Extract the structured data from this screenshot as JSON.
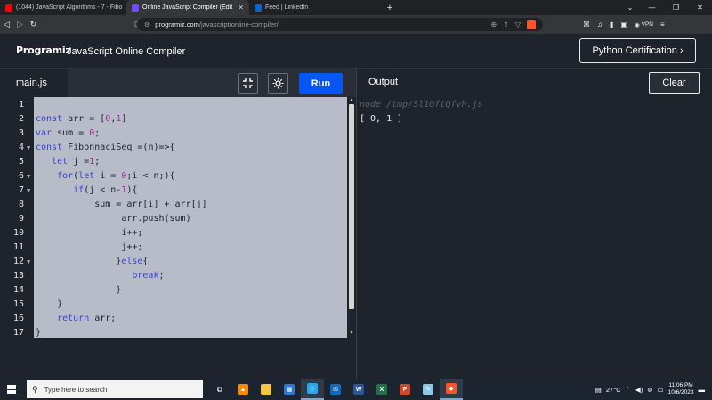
{
  "browser": {
    "tabs": [
      {
        "title": "(1044) JavaScript Algorithms - 7 - Fibo",
        "color": "#ff0000"
      },
      {
        "title": "Online JavaScript Compiler (Edit",
        "color": "#6c4df6",
        "active": true
      },
      {
        "title": "Feed | LinkedIn",
        "color": "#0a66c2"
      }
    ],
    "new_tab_label": "+",
    "address": {
      "host": "programiz.com",
      "path": "/javascript/online-compiler/"
    },
    "vpn_label": "VPN"
  },
  "site": {
    "logo": "Programiz",
    "title": "JavaScript Online Compiler",
    "cert_button": "Python Certification ›"
  },
  "editor": {
    "file_name": "main.js",
    "run_label": "Run",
    "lines": [
      {
        "n": "1",
        "code": ""
      },
      {
        "n": "2",
        "code": "const arr = [0,1]"
      },
      {
        "n": "3",
        "code": "var sum = 0;"
      },
      {
        "n": "4",
        "code": "const FibonnaciSeq =(n)=>{",
        "fold": true
      },
      {
        "n": "5",
        "code": "   let j =1;"
      },
      {
        "n": "6",
        "code": "    for(let i = 0;i < n;){",
        "fold": true
      },
      {
        "n": "7",
        "code": "       if(j < n-1){",
        "fold": true
      },
      {
        "n": "8",
        "code": "           sum = arr[i] + arr[j]"
      },
      {
        "n": "9",
        "code": "                arr.push(sum)"
      },
      {
        "n": "10",
        "code": "                i++;"
      },
      {
        "n": "11",
        "code": "                j++;"
      },
      {
        "n": "12",
        "code": "               }else{",
        "fold": true
      },
      {
        "n": "13",
        "code": "                  break;"
      },
      {
        "n": "14",
        "code": "               }"
      },
      {
        "n": "15",
        "code": "    }"
      },
      {
        "n": "16",
        "code": "    return arr;"
      },
      {
        "n": "17",
        "code": "}"
      }
    ]
  },
  "output": {
    "title": "Output",
    "clear_label": "Clear",
    "command": "node /tmp/Sl1OftQfvh.js",
    "result": "[ 0, 1 ]"
  },
  "taskbar": {
    "search_placeholder": "Type here to search",
    "weather": "27°C",
    "time": "11:06 PM",
    "date": "10/6/2023"
  }
}
